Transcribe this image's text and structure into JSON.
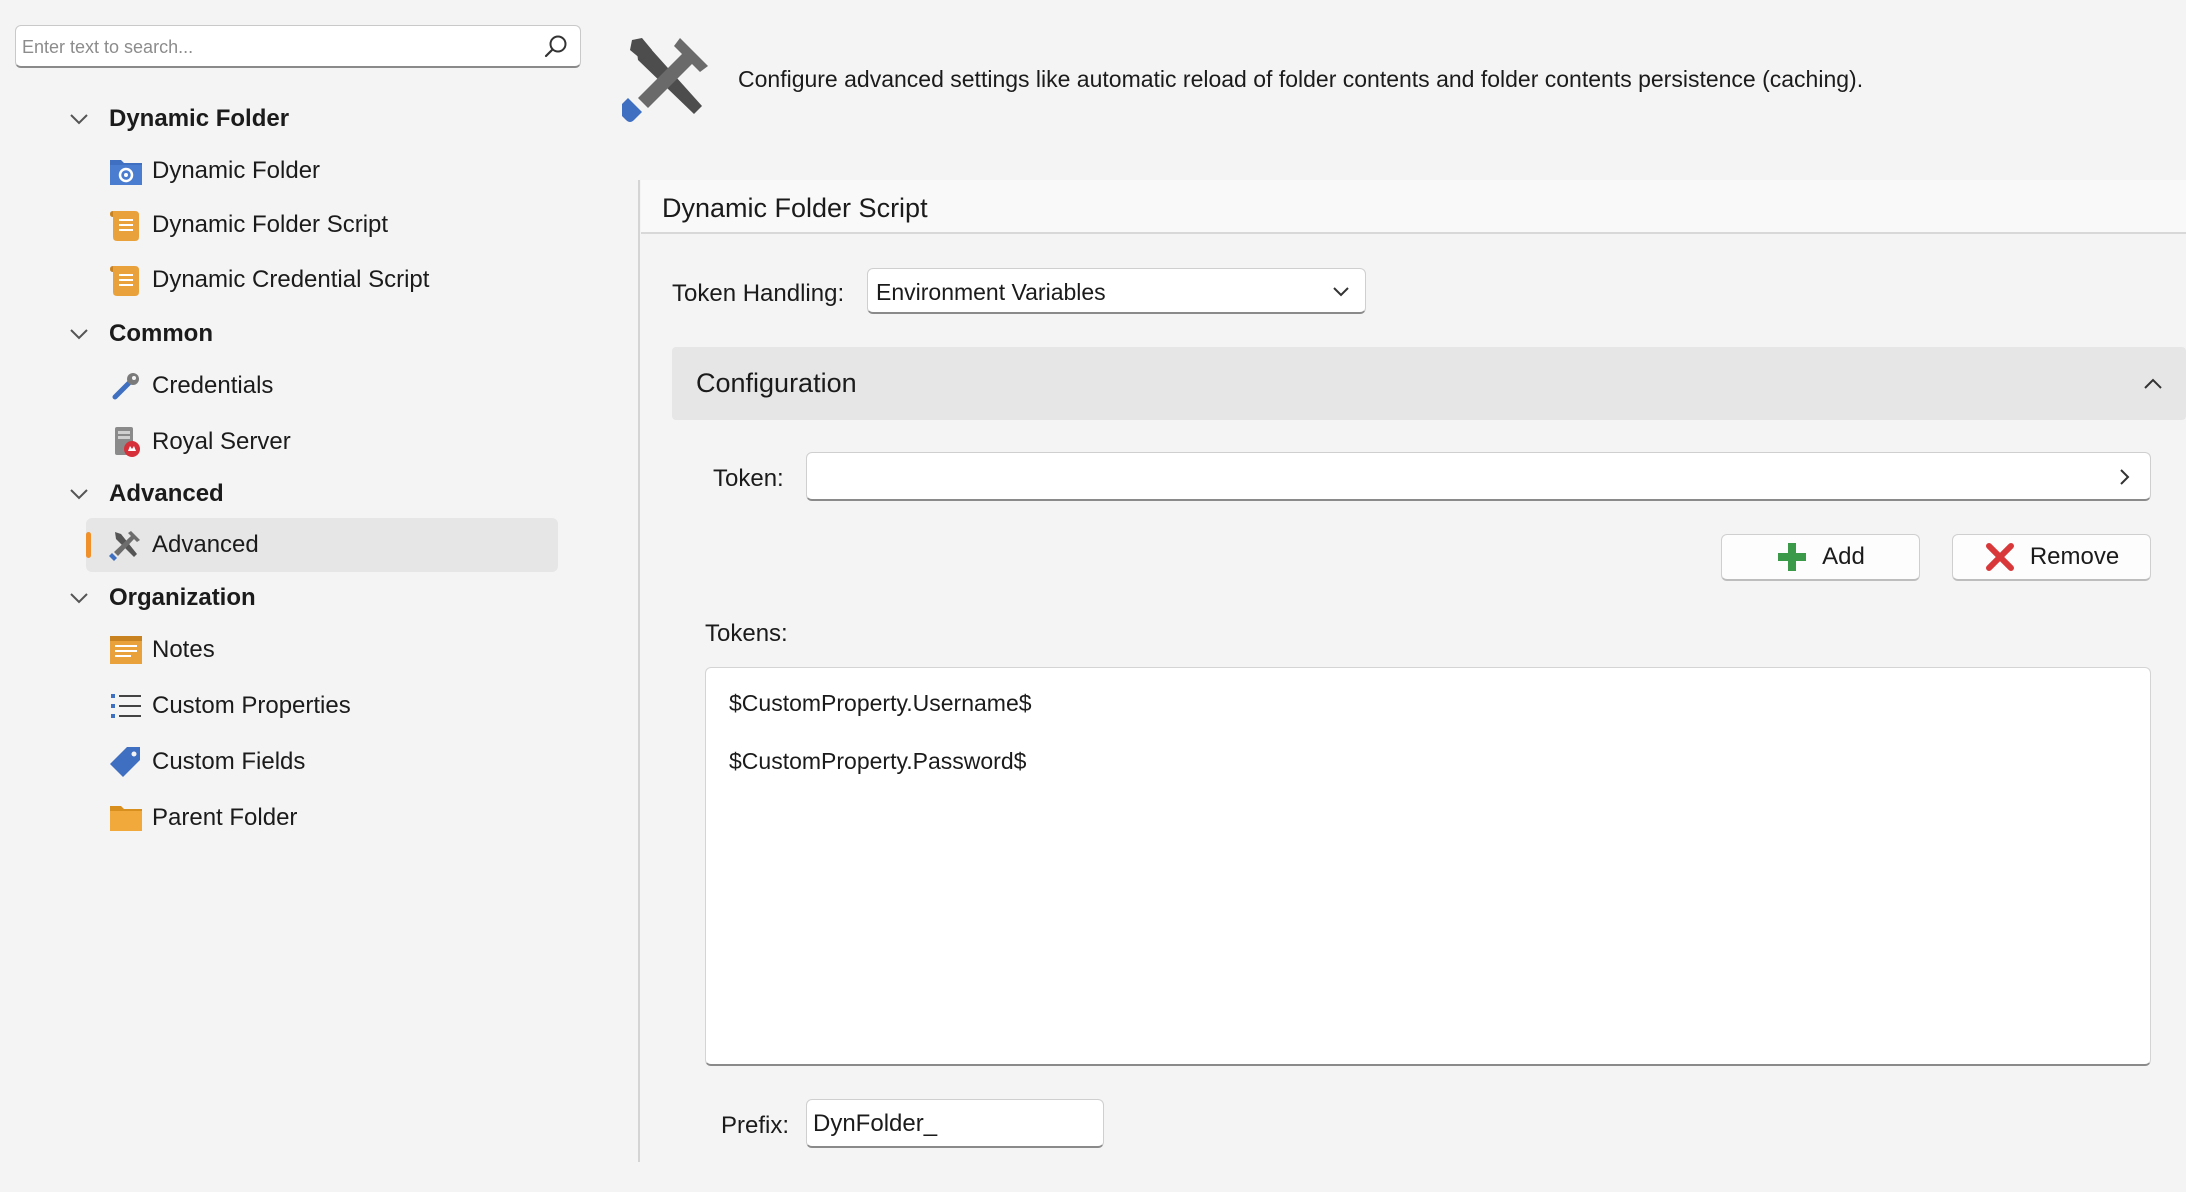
{
  "search": {
    "placeholder": "Enter text to search..."
  },
  "sidebar": {
    "groups": [
      {
        "label": "Dynamic Folder",
        "items": [
          {
            "label": "Dynamic Folder",
            "icon": "folder-gear-icon"
          },
          {
            "label": "Dynamic Folder Script",
            "icon": "script-icon"
          },
          {
            "label": "Dynamic Credential Script",
            "icon": "script-icon"
          }
        ]
      },
      {
        "label": "Common",
        "items": [
          {
            "label": "Credentials",
            "icon": "key-icon"
          },
          {
            "label": "Royal Server",
            "icon": "server-icon"
          }
        ]
      },
      {
        "label": "Advanced",
        "items": [
          {
            "label": "Advanced",
            "icon": "tools-icon",
            "selected": true
          }
        ]
      },
      {
        "label": "Organization",
        "items": [
          {
            "label": "Notes",
            "icon": "notes-icon"
          },
          {
            "label": "Custom Properties",
            "icon": "list-icon"
          },
          {
            "label": "Custom Fields",
            "icon": "tag-icon"
          },
          {
            "label": "Parent Folder",
            "icon": "folder-icon"
          }
        ]
      }
    ]
  },
  "header": {
    "icon": "tools-icon",
    "description": "Configure advanced settings like automatic reload of folder contents and folder contents persistence (caching)."
  },
  "panel": {
    "title": "Dynamic Folder Script",
    "token_handling_label": "Token Handling:",
    "token_handling_value": "Environment Variables",
    "section_title": "Configuration",
    "token_label": "Token:",
    "token_value": "",
    "add_label": "Add",
    "remove_label": "Remove",
    "tokens_label": "Tokens:",
    "tokens": [
      "$CustomProperty.Username$",
      "$CustomProperty.Password$"
    ],
    "prefix_label": "Prefix:",
    "prefix_value": "DynFolder_"
  },
  "colors": {
    "accent": "#f0902a",
    "add_green": "#3a9a4a",
    "remove_red": "#d9383a",
    "icon_blue": "#3f6fc0",
    "icon_orange": "#e9a23b"
  }
}
